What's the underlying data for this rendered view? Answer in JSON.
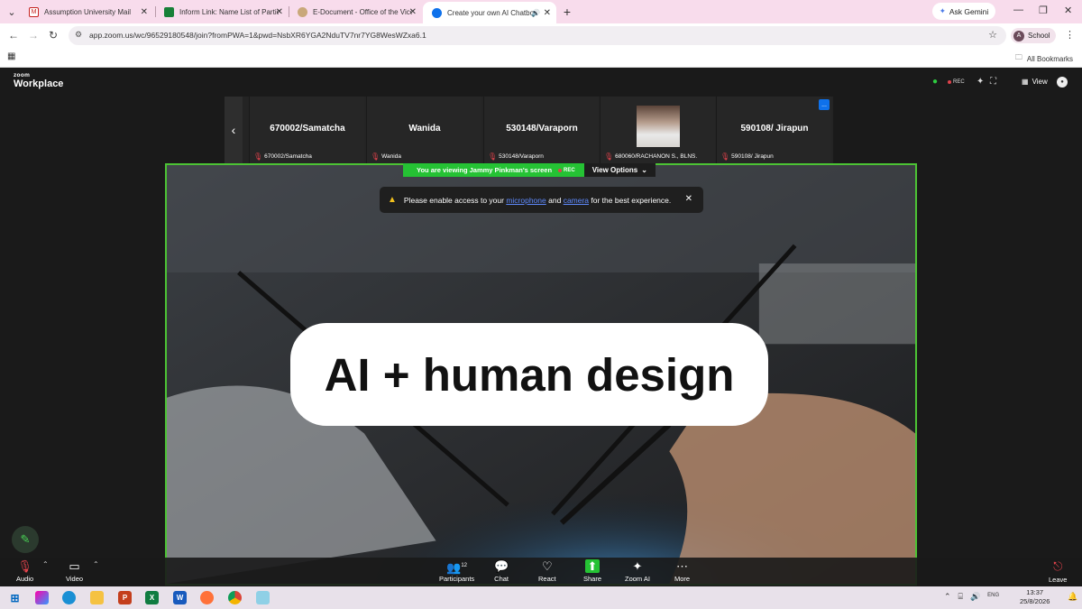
{
  "browser": {
    "tabs": [
      {
        "title": "Assumption University Mail",
        "favicon": "gmail-icon",
        "color": "#c5221f"
      },
      {
        "title": "Inform Link: Name List of Partic",
        "favicon": "sheets-icon",
        "color": "#188038"
      },
      {
        "title": "E-Document - Office of the Vice",
        "favicon": "seal-icon",
        "color": "#8a6d3b"
      },
      {
        "title": "Create your own AI Chatbot",
        "favicon": "zoom-icon",
        "color": "#0e71eb"
      }
    ],
    "ask_gemini": "Ask Gemini",
    "url": "app.zoom.us/wc/96529180548/join?fromPWA=1&pwd=NsbXR6YGA2NduTV7nr7YG8WesWZxa6.1",
    "profile_initial": "A",
    "profile_label": "School",
    "all_bookmarks": "All Bookmarks"
  },
  "zoom": {
    "logo_top": "zoom",
    "logo_bottom": "Workplace",
    "rec": "REC",
    "view": "View",
    "thumbnails": [
      {
        "name": "670002/Samatcha",
        "label": "670002/Samatcha"
      },
      {
        "name": "Wanida",
        "label": "Wanida"
      },
      {
        "name": "530148/Varaporn",
        "label": "530148/Varaporn"
      },
      {
        "name": "",
        "label": "680060/RACHANON S., BLNS."
      },
      {
        "name": "590108/ Jirapun",
        "label": "590108/ Jirapun"
      }
    ],
    "more_thumbs": "...",
    "viewing": "You are viewing  Jammy Pinkman's screen",
    "viewing_rec": "REC",
    "view_options": "View Options",
    "notice": {
      "prefix": "Please enable access to your",
      "mic": "microphone",
      "and": "and",
      "cam": "camera",
      "suffix": "for the best experience."
    },
    "slide_headline": "AI + human design",
    "toolbar": {
      "audio": "Audio",
      "video": "Video",
      "participants": "Participants",
      "participants_count": "12",
      "chat": "Chat",
      "react": "React",
      "share": "Share",
      "zoom_ai": "Zoom AI",
      "more": "More",
      "leave": "Leave"
    }
  },
  "taskbar": {
    "time": "13:37",
    "date": "25/8/2026",
    "lang": "ENG"
  }
}
